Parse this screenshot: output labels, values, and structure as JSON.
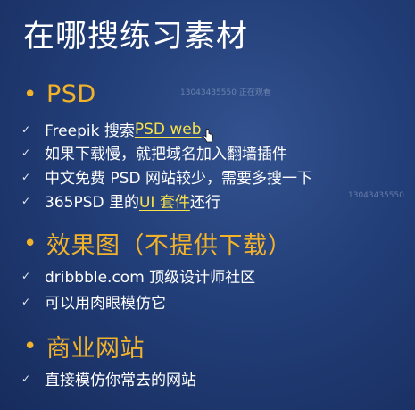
{
  "title": "在哪搜练习素材",
  "watermarks": {
    "top": "13043435550 正在观看",
    "side": "13043435550"
  },
  "sections": [
    {
      "bullet": "•",
      "label": "PSD",
      "items": [
        {
          "check": "✓",
          "pre": "Freepik 搜索 ",
          "highlight": "PSD web",
          "post": ""
        },
        {
          "check": "✓",
          "pre": "如果下载慢，就把域名加入翻墙插件",
          "highlight": "",
          "post": ""
        },
        {
          "check": "✓",
          "pre": "中文免费 PSD 网站较少，需要多搜一下",
          "highlight": "",
          "post": ""
        },
        {
          "check": "✓",
          "pre": "365PSD 里的 ",
          "highlight": "UI 套件",
          "post": "还行"
        }
      ]
    },
    {
      "bullet": "•",
      "label": "效果图（不提供下载）",
      "items": [
        {
          "check": "✓",
          "pre": "dribbble.com 顶级设计师社区",
          "highlight": "",
          "post": ""
        },
        {
          "check": "✓",
          "pre": "可以用肉眼模仿它",
          "highlight": "",
          "post": ""
        }
      ]
    },
    {
      "bullet": "•",
      "label": "商业网站",
      "items": [
        {
          "check": "✓",
          "pre": "直接模仿你常去的网站",
          "highlight": "",
          "post": ""
        }
      ]
    }
  ]
}
